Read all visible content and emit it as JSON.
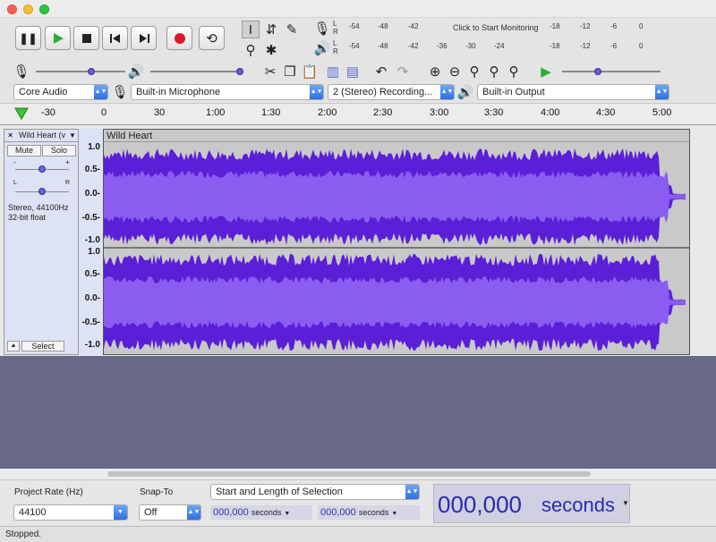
{
  "colors": {
    "waveform": "#5a1fd6",
    "waveform_light": "#8a5cf0",
    "background_area": "#686888",
    "record": "#e0152e",
    "play": "#2cae34"
  },
  "window": {
    "buttons": [
      "close",
      "minimize",
      "zoom"
    ]
  },
  "meters": {
    "record_hint": "Click to Start Monitoring",
    "scale": [
      "-54",
      "-48",
      "-42",
      "-18",
      "-12",
      "-6",
      "0"
    ],
    "playback_scale": [
      "-54",
      "-48",
      "-42",
      "-36",
      "-30",
      "-24",
      "-18",
      "-12",
      "-6",
      "0"
    ],
    "channel_left": "L",
    "channel_right": "R"
  },
  "devices": {
    "host": "Core Audio",
    "input": "Built-in Microphone",
    "channels": "2 (Stereo) Recording...",
    "output": "Built-in Output"
  },
  "ruler": {
    "ticks": [
      "-30",
      "0",
      "30",
      "1:00",
      "1:30",
      "2:00",
      "2:30",
      "3:00",
      "3:30",
      "4:00",
      "4:30",
      "5:00"
    ]
  },
  "track": {
    "name": "Wild Heart (vo",
    "full_name": "Wild Heart",
    "mute": "Mute",
    "solo": "Solo",
    "gain_minus": "-",
    "gain_plus": "+",
    "pan_l": "L",
    "pan_r": "R",
    "info_line1": "Stereo, 44100Hz",
    "info_line2": "32-bit float",
    "select": "Select",
    "close": "×",
    "menu_arrow": "▼",
    "collapse": "▲",
    "gain_level": 0.5,
    "pan_level": 0.5
  },
  "vscale": {
    "top": [
      "1.0",
      "0.5-",
      "0.0-",
      "-0.5-",
      "-1.0"
    ],
    "bottom": [
      "1.0",
      "0.5-",
      "0.0-",
      "-0.5-",
      "-1.0"
    ]
  },
  "bottom": {
    "rate_label": "Project Rate (Hz)",
    "rate_value": "44100",
    "snap_label": "Snap-To",
    "snap_value": "Off",
    "selection_mode": "Start and Length of Selection",
    "sel_start_num": "000,000",
    "sel_start_unit": "seconds",
    "sel_len_num": "000,000",
    "sel_len_unit": "seconds",
    "position_num": "000,000",
    "position_unit": "seconds"
  },
  "status": "Stopped."
}
